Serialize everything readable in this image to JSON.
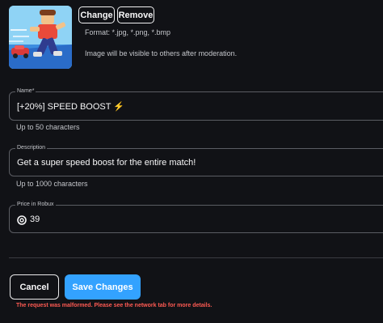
{
  "image_editor": {
    "change_label": "Change",
    "remove_label": "Remove",
    "format_hint": "Format: *.jpg, *.png, *.bmp",
    "moderation_hint": "Image will be visible to others after moderation."
  },
  "name_field": {
    "label": "Name",
    "required_marker": "*",
    "value": "[+20%] SPEED BOOST ⚡",
    "helper": "Up to 50 characters"
  },
  "description_field": {
    "label": "Description",
    "value": "Get a super speed boost for the entire match!",
    "helper": "Up to 1000 characters"
  },
  "price_field": {
    "label": "Price in Robux",
    "value": "39",
    "icon": "robux-icon"
  },
  "actions": {
    "cancel_label": "Cancel",
    "save_label": "Save Changes"
  },
  "error_message": "The request was malformed. Please see the network tab for more details.",
  "colors": {
    "background": "#111216",
    "primary_button": "#33a2ff",
    "error": "#ff5a52",
    "field_border": "#5b5d63"
  }
}
